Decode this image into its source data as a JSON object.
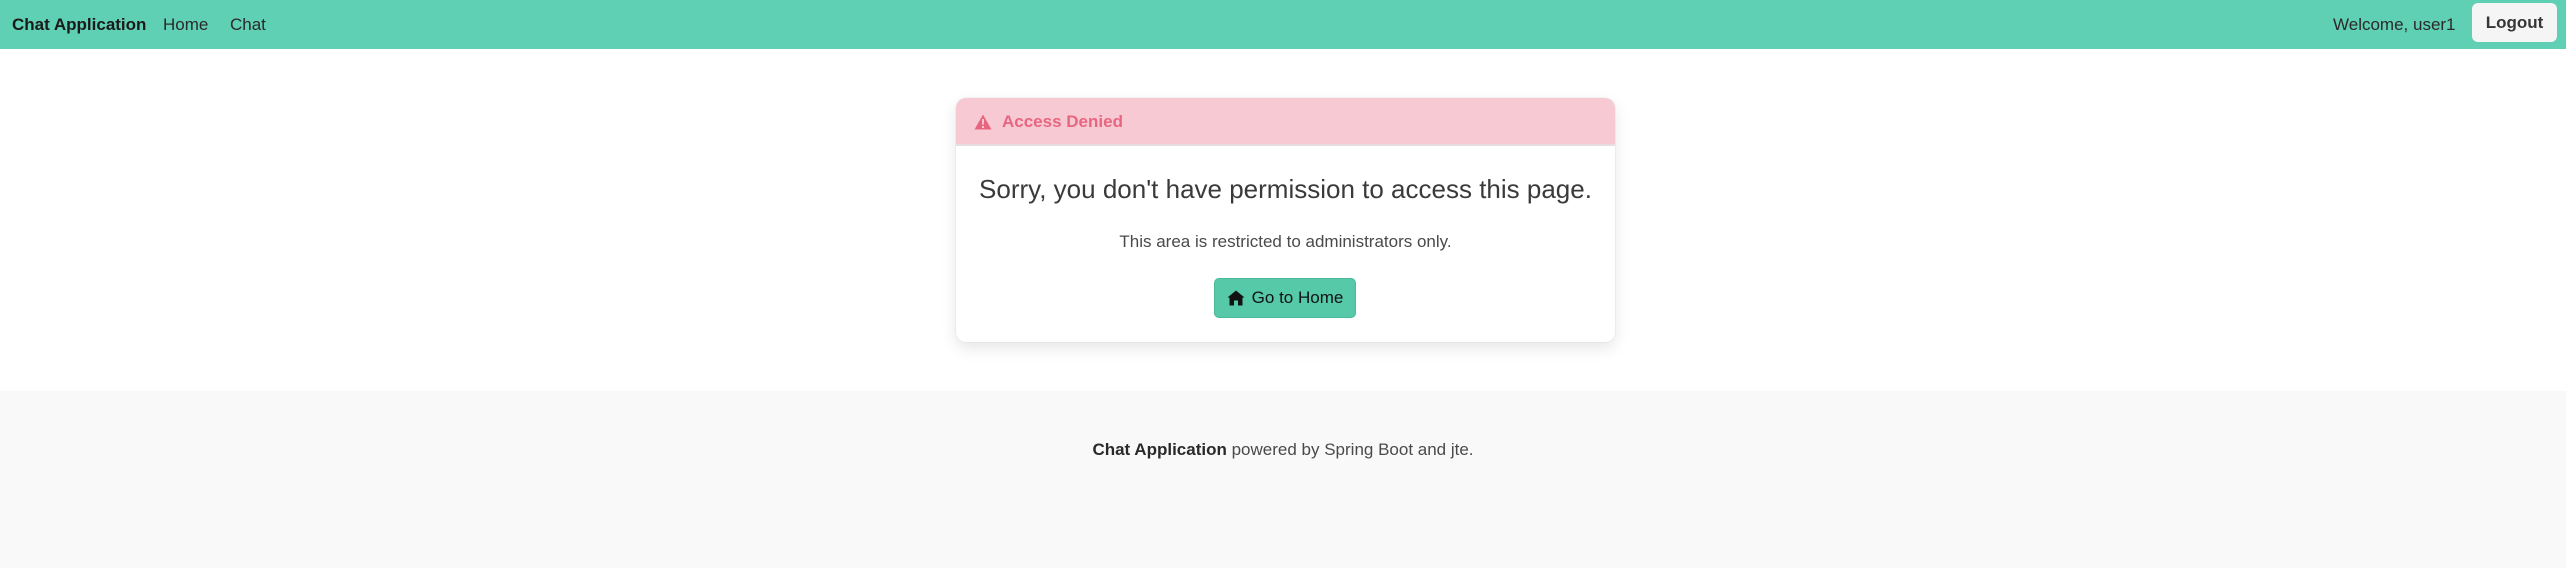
{
  "navbar": {
    "brand": "Chat Application",
    "links": [
      {
        "label": "Home"
      },
      {
        "label": "Chat"
      }
    ],
    "welcome": "Welcome, user1",
    "logout_label": "Logout",
    "background_color": "#5fd0b3"
  },
  "alert": {
    "icon": "warning-triangle-icon",
    "title": "Access Denied",
    "message": "Sorry, you don't have permission to access this page.",
    "detail": "This area is restricted to administrators only.",
    "home_button": {
      "icon": "home-icon",
      "label": "Go to Home"
    },
    "header_color": "#f7cad3",
    "title_color": "#e86580",
    "button_color": "#55c9a8"
  },
  "footer": {
    "app_name": "Chat Application",
    "powered_by": " powered by Spring Boot and jte."
  }
}
